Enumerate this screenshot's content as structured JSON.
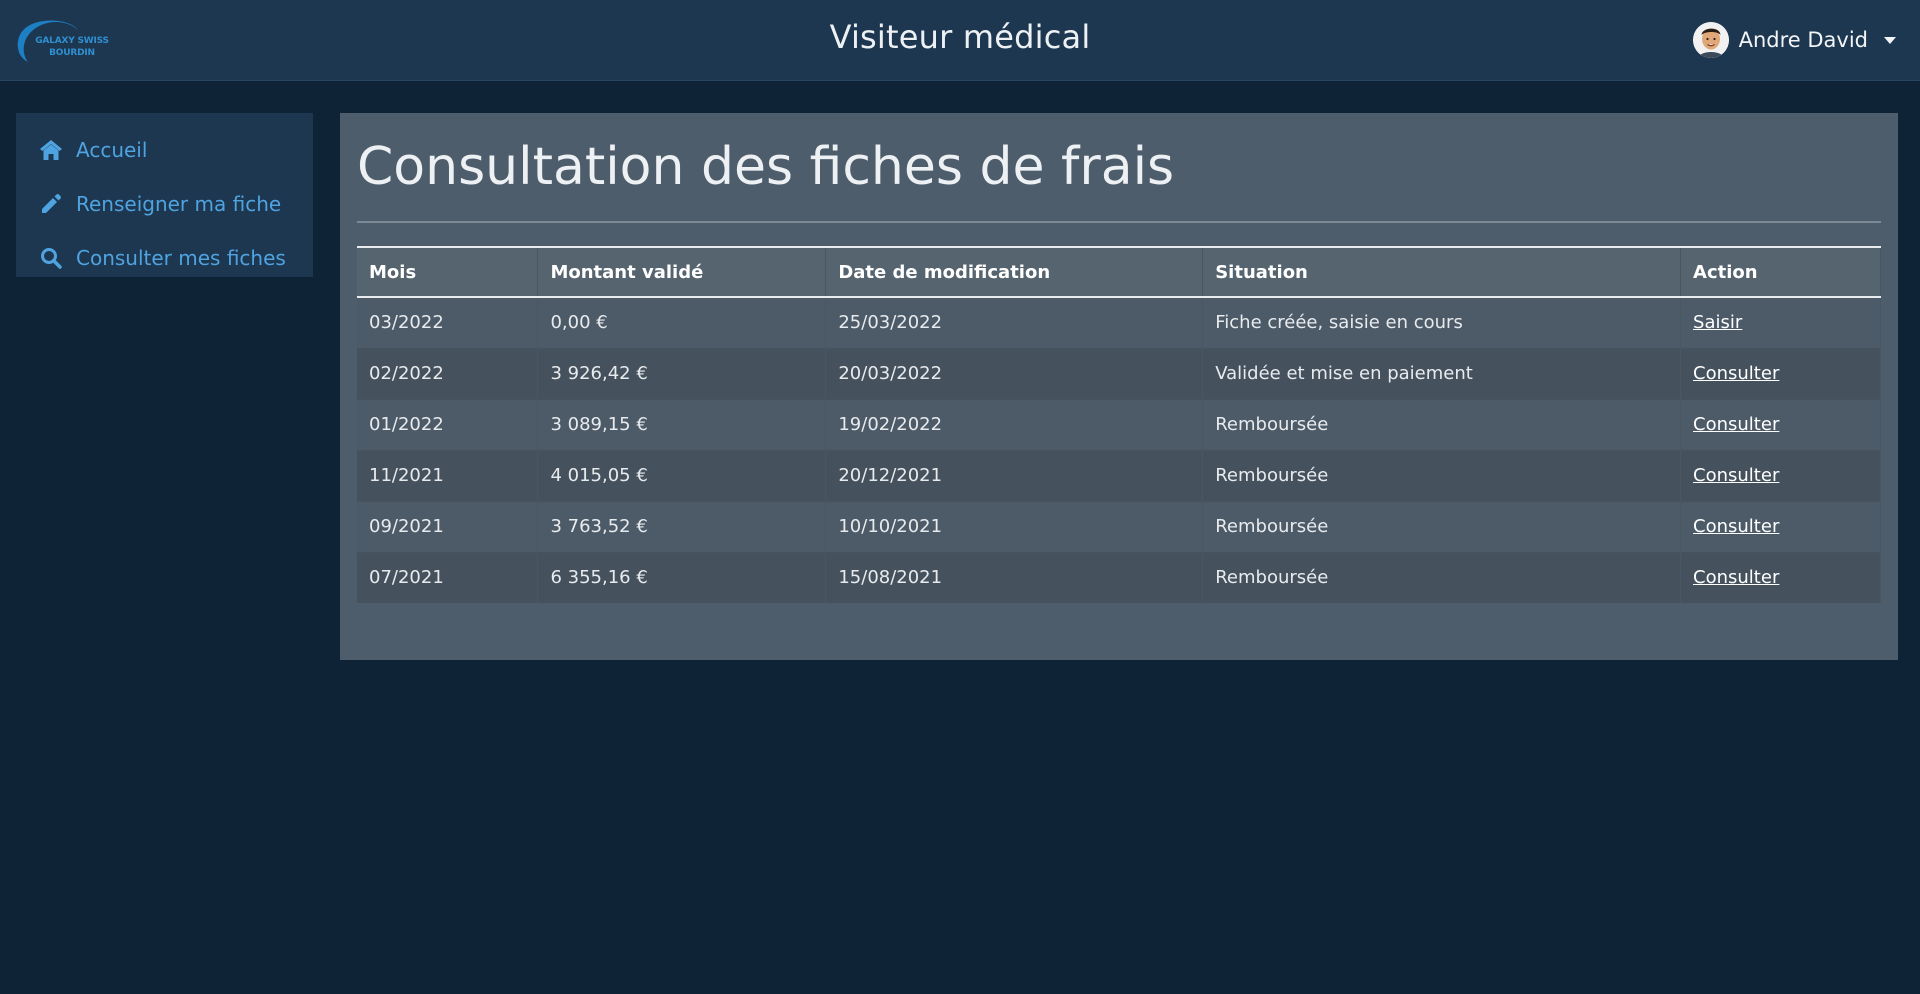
{
  "header": {
    "logo_line1": "GALAXY SWISS",
    "logo_line2": "BOURDIN",
    "title": "Visiteur médical",
    "user_name": "Andre David"
  },
  "sidebar": {
    "items": [
      {
        "label": "Accueil",
        "icon": "home-icon"
      },
      {
        "label": "Renseigner ma fiche",
        "icon": "pencil-icon"
      },
      {
        "label": "Consulter mes fiches",
        "icon": "search-icon"
      }
    ]
  },
  "main": {
    "title": "Consultation des fiches de frais",
    "columns": [
      "Mois",
      "Montant validé",
      "Date de modification",
      "Situation",
      "Action"
    ],
    "rows": [
      {
        "mois": "03/2022",
        "montant": "0,00 €",
        "date": "25/03/2022",
        "situation": "Fiche créée, saisie en cours",
        "action": "Saisir"
      },
      {
        "mois": "02/2022",
        "montant": "3 926,42 €",
        "date": "20/03/2022",
        "situation": "Validée et mise en paiement",
        "action": "Consulter"
      },
      {
        "mois": "01/2022",
        "montant": "3 089,15 €",
        "date": "19/02/2022",
        "situation": "Remboursée",
        "action": "Consulter"
      },
      {
        "mois": "11/2021",
        "montant": "4 015,05 €",
        "date": "20/12/2021",
        "situation": "Remboursée",
        "action": "Consulter"
      },
      {
        "mois": "09/2021",
        "montant": "3 763,52 €",
        "date": "10/10/2021",
        "situation": "Remboursée",
        "action": "Consulter"
      },
      {
        "mois": "07/2021",
        "montant": "6 355,16 €",
        "date": "15/08/2021",
        "situation": "Remboursée",
        "action": "Consulter"
      }
    ]
  },
  "colors": {
    "page_bg": "#0f2336",
    "header_bg": "#1e3750",
    "panel_bg": "#4e5d6c",
    "link_blue": "#4fa3e0",
    "logo_blue": "#2f8fd0"
  }
}
